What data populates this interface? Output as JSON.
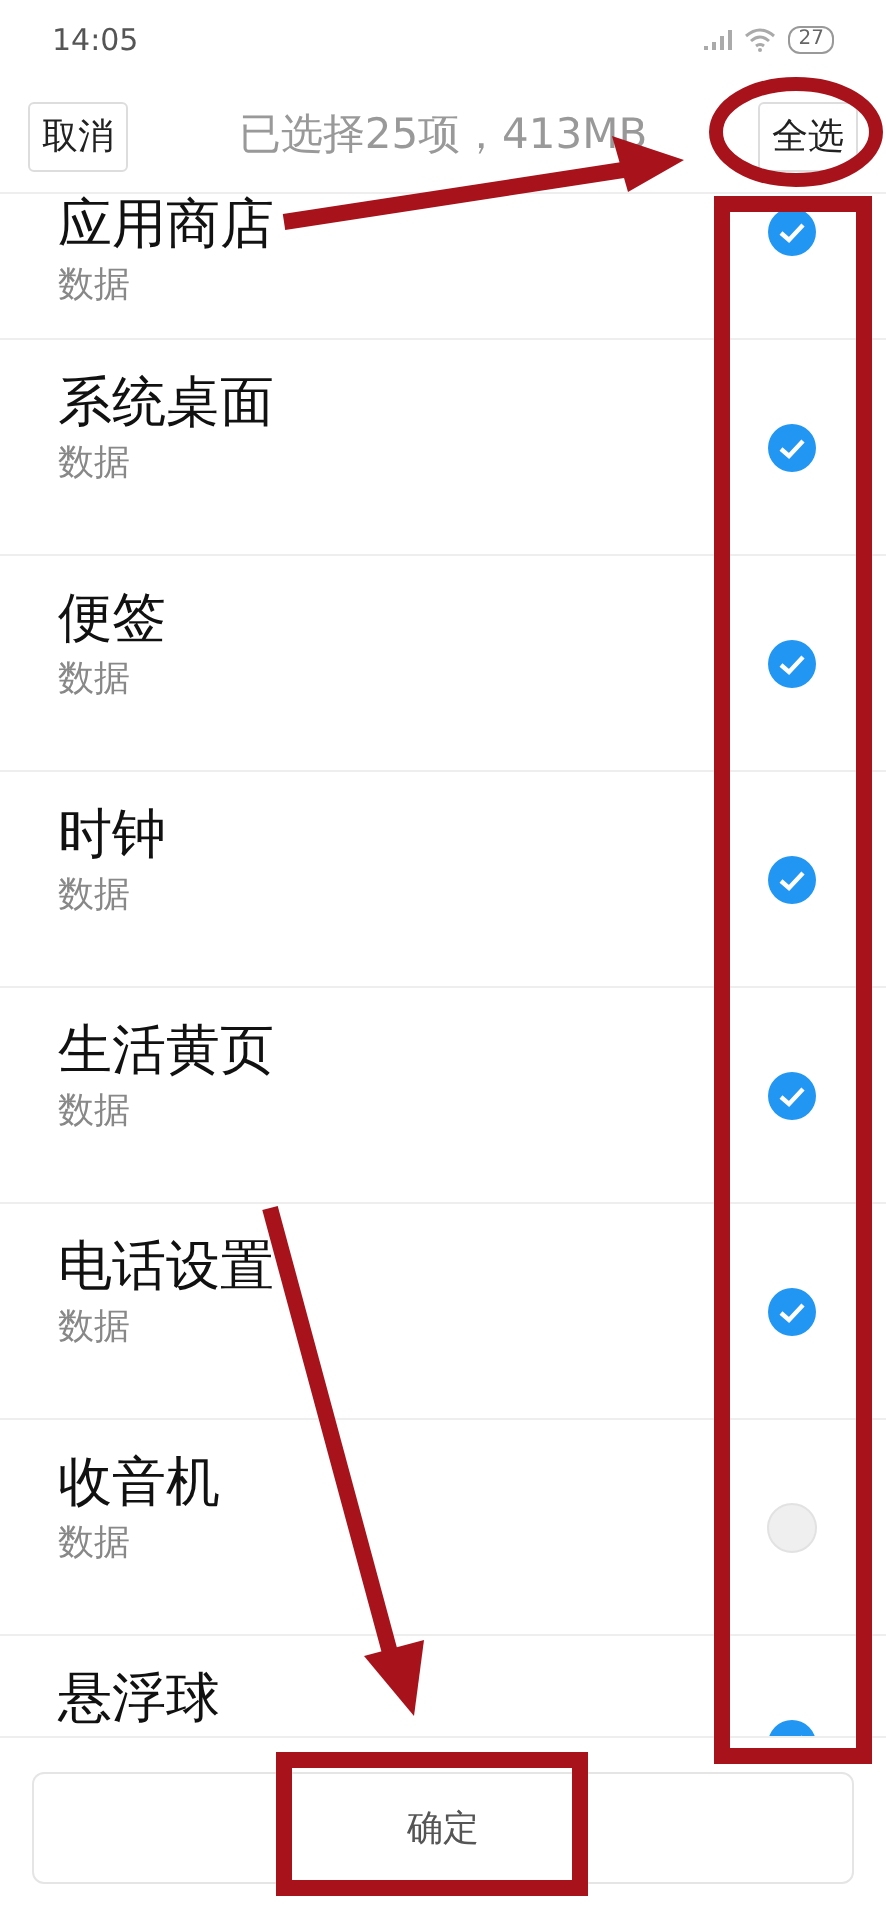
{
  "status_bar": {
    "time": "14:05",
    "battery": "27"
  },
  "header": {
    "cancel": "取消",
    "title": "已选择25项，413MB",
    "select_all": "全选"
  },
  "items": [
    {
      "title": "应用商店",
      "subtitle": "数据",
      "checked": true
    },
    {
      "title": "系统桌面",
      "subtitle": "数据",
      "checked": true
    },
    {
      "title": "便签",
      "subtitle": "数据",
      "checked": true
    },
    {
      "title": "时钟",
      "subtitle": "数据",
      "checked": true
    },
    {
      "title": "生活黄页",
      "subtitle": "数据",
      "checked": true
    },
    {
      "title": "电话设置",
      "subtitle": "数据",
      "checked": true
    },
    {
      "title": "收音机",
      "subtitle": "数据",
      "checked": false
    },
    {
      "title": "悬浮球",
      "checked": true
    }
  ],
  "footer": {
    "confirm": "确定"
  }
}
